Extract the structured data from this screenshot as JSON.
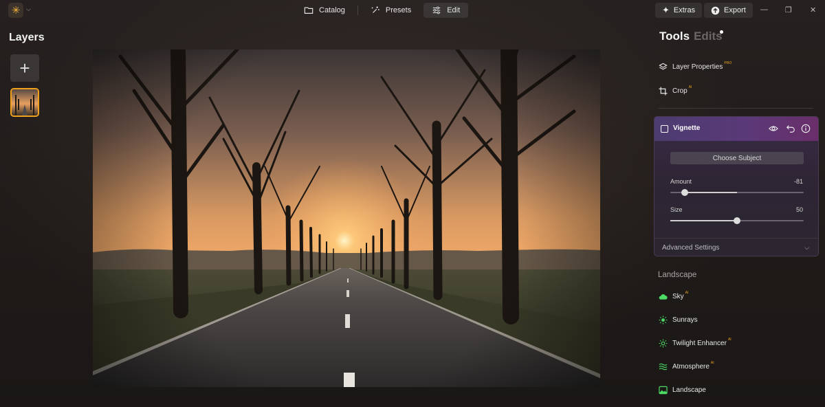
{
  "topbar": {
    "logo_icon": "sun-logo-icon",
    "tabs": [
      {
        "label": "Catalog",
        "icon": "folder-icon",
        "active": false
      },
      {
        "label": "Presets",
        "icon": "sparkle-wand-icon",
        "active": false
      },
      {
        "label": "Edit",
        "icon": "sliders-icon",
        "active": true
      }
    ],
    "extras_label": "Extras",
    "export_label": "Export"
  },
  "layers": {
    "title": "Layers",
    "add_icon": "plus-icon",
    "thumbnail": "road-sunset-thumbnail"
  },
  "panel": {
    "tab_tools": "Tools",
    "tab_edits": "Edits",
    "items": [
      {
        "label": "Layer Properties",
        "badge": "PRO",
        "icon": "layers-stack-icon"
      },
      {
        "label": "Crop",
        "badge": "AI",
        "icon": "crop-icon"
      }
    ],
    "vignette": {
      "title": "Vignette",
      "choose_subject": "Choose Subject",
      "amount_label": "Amount",
      "amount_value": "-81",
      "amount_fraction": 0.11,
      "size_label": "Size",
      "size_value": "50",
      "size_fraction": 0.5,
      "advanced_label": "Advanced Settings"
    },
    "landscape_title": "Landscape",
    "landscape_items": [
      {
        "label": "Sky",
        "badge": "AI",
        "icon": "cloud-icon"
      },
      {
        "label": "Sunrays",
        "badge": "",
        "icon": "sun-rays-icon"
      },
      {
        "label": "Twilight Enhancer",
        "badge": "AI",
        "icon": "twilight-sun-icon"
      },
      {
        "label": "Atmosphere",
        "badge": "AI",
        "icon": "waves-icon"
      },
      {
        "label": "Landscape",
        "badge": "",
        "icon": "landscape-image-icon"
      }
    ]
  },
  "colors": {
    "accent": "#f0a21c",
    "green_icon": "#4cd964",
    "vignette_header": "#5a3978"
  }
}
